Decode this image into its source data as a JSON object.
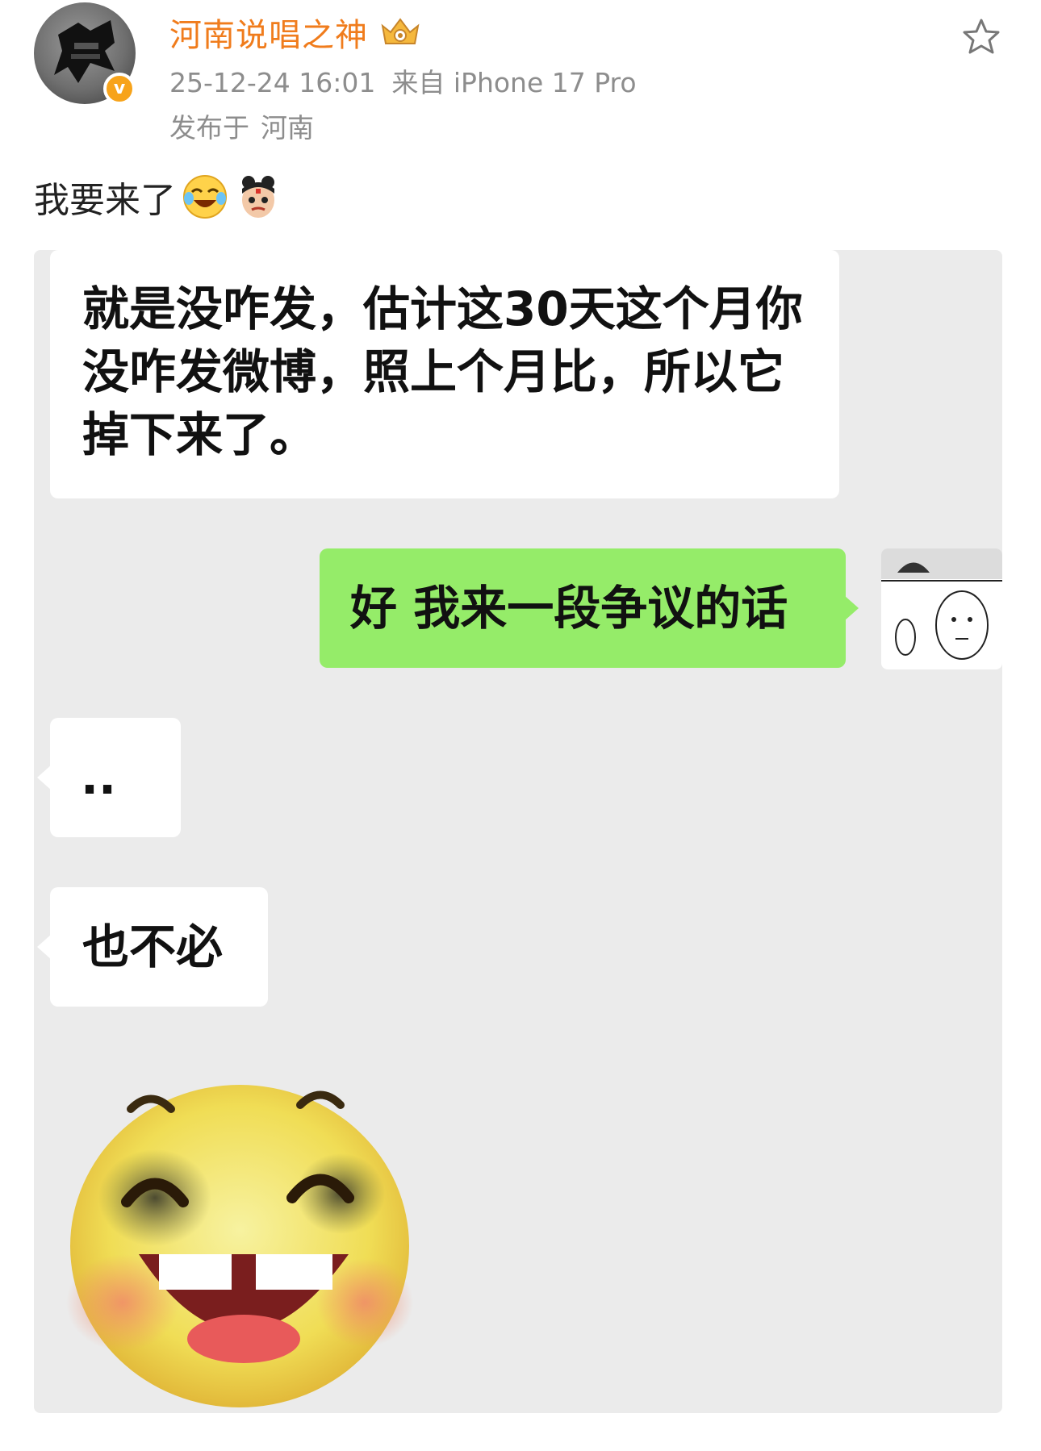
{
  "post": {
    "username": "河南说唱之神",
    "timestamp": "25-12-24 16:01",
    "source": "来自 iPhone 17 Pro",
    "location_prefix": "发布于",
    "location": "河南",
    "verified_mark": "v",
    "text": "我要来了",
    "emojis": [
      "laughing-crying-emoji",
      "nezha-emoji"
    ],
    "favorite_icon": "star-icon"
  },
  "chat_image": {
    "messages": [
      {
        "side": "left",
        "text": "就是没咋发，估计这30天这个月你没咋发微博，照上个月比，所以它掉下来了。"
      },
      {
        "side": "right",
        "text": "好 我来一段争议的话"
      },
      {
        "side": "left",
        "text": ".."
      },
      {
        "side": "left",
        "text": "也不必"
      }
    ],
    "sticker": "laughing-face-sticker",
    "colors": {
      "background": "#ebebeb",
      "incoming_bubble": "#ffffff",
      "outgoing_bubble": "#95ec69"
    }
  },
  "colors": {
    "username": "#f07c1c",
    "meta": "#8d8d8d",
    "badge": "#f7a31a"
  }
}
